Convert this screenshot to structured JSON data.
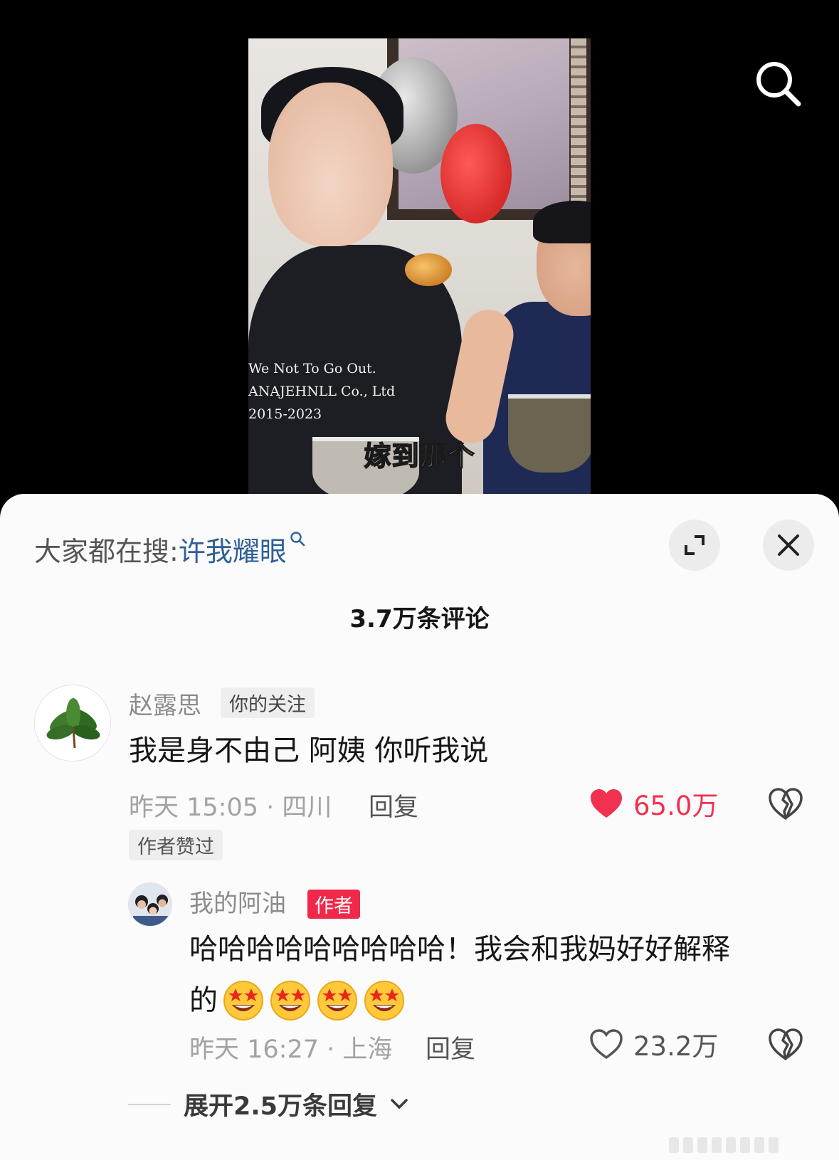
{
  "video": {
    "subtitle": "嫁到那个",
    "shirt_lines": [
      "We Not To Go Out.",
      "ANAJEHNLL Co., Ltd",
      "2015-2023"
    ]
  },
  "header": {
    "search_icon": "search-icon"
  },
  "sheet": {
    "hot_search_prefix": "大家都在搜:",
    "hot_search_term": "许我耀眼",
    "comment_count": "3.7万条评论",
    "expand_icon": "expand-icon",
    "close_icon": "close-icon"
  },
  "comments": [
    {
      "username": "赵露思",
      "tag": "你的关注",
      "text": "我是身不由己 阿姨 你听我说",
      "meta": "昨天 15:05 · 四川",
      "reply_label": "回复",
      "likes": "65.0万",
      "liked": true,
      "badge": "作者赞过",
      "avatar": "leaf-avatar"
    },
    {
      "username": "我的阿油",
      "tag": "作者",
      "text": "哈哈哈哈哈哈哈哈哈！我会和我妈好好解释",
      "text_line2": "的",
      "emoji_count": 4,
      "emoji": "star-struck-emoji",
      "meta": "昨天 16:27 · 上海",
      "reply_label": "回复",
      "likes": "23.2万",
      "liked": false,
      "avatar": "group-photo-avatar"
    }
  ],
  "expand_replies": "展开2.5万条回复",
  "colors": {
    "accent_red": "#f0284a",
    "like_red": "#f2304f",
    "link_blue": "#2f5f98",
    "sheet_bg": "#fbfbfb"
  }
}
